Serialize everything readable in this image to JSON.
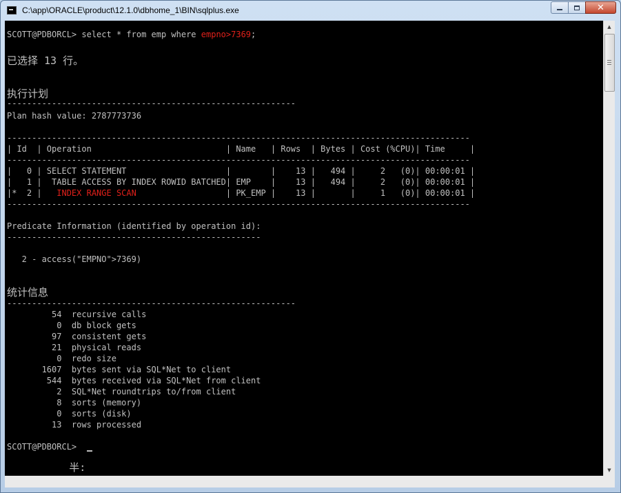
{
  "window": {
    "title": "C:\\app\\ORACLE\\product\\12.1.0\\dbhome_1\\BIN\\sqlplus.exe"
  },
  "console": {
    "lines": [
      {
        "a": "SCOTT@PDBORCL> select * from emp where ",
        "b": "empno>7369",
        "c": ";"
      },
      {
        "a": "已选择 13 行。",
        "b": "",
        "c": ""
      },
      {
        "a": "执行计划",
        "b": "",
        "c": ""
      },
      {
        "a": "----------------------------------------------------------",
        "b": "",
        "c": ""
      },
      {
        "a": "Plan hash value: 2787773736",
        "b": "",
        "c": ""
      },
      {
        "a": "---------------------------------------------------------------------------------------------",
        "b": "",
        "c": ""
      },
      {
        "a": "| Id  | Operation                           | Name   | Rows  | Bytes | Cost (%CPU)| Time     |",
        "b": "",
        "c": ""
      },
      {
        "a": "---------------------------------------------------------------------------------------------",
        "b": "",
        "c": ""
      },
      {
        "a": "|   0 | SELECT STATEMENT                    |        |    13 |   494 |     2   (0)| 00:00:01 |",
        "b": "",
        "c": ""
      },
      {
        "a": "|   1 |  TABLE ACCESS BY INDEX ROWID BATCHED| EMP    |    13 |   494 |     2   (0)| 00:00:01 |",
        "b": "",
        "c": ""
      },
      {
        "a": "|*  2 |   ",
        "b": "INDEX RANGE SCAN",
        "c": "                  | PK_EMP |    13 |       |     1   (0)| 00:00:01 |"
      },
      {
        "a": "---------------------------------------------------------------------------------------------",
        "b": "",
        "c": ""
      },
      {
        "a": "Predicate Information (identified by operation id):",
        "b": "",
        "c": ""
      },
      {
        "a": "---------------------------------------------------",
        "b": "",
        "c": ""
      },
      {
        "a": "   2 - access(\"EMPNO\">7369)",
        "b": "",
        "c": ""
      },
      {
        "a": "统计信息",
        "b": "",
        "c": ""
      },
      {
        "a": "----------------------------------------------------------",
        "b": "",
        "c": ""
      },
      {
        "a": "         54  recursive calls",
        "b": "",
        "c": ""
      },
      {
        "a": "          0  db block gets",
        "b": "",
        "c": ""
      },
      {
        "a": "         97  consistent gets",
        "b": "",
        "c": ""
      },
      {
        "a": "         21  physical reads",
        "b": "",
        "c": ""
      },
      {
        "a": "          0  redo size",
        "b": "",
        "c": ""
      },
      {
        "a": "       1607  bytes sent via SQL*Net to client",
        "b": "",
        "c": ""
      },
      {
        "a": "        544  bytes received via SQL*Net from client",
        "b": "",
        "c": ""
      },
      {
        "a": "          2  SQL*Net roundtrips to/from client",
        "b": "",
        "c": ""
      },
      {
        "a": "          8  sorts (memory)",
        "b": "",
        "c": ""
      },
      {
        "a": "          0  sorts (disk)",
        "b": "",
        "c": ""
      },
      {
        "a": "         13  rows processed",
        "b": "",
        "c": ""
      },
      {
        "a": "SCOTT@PDBORCL> ",
        "b": "",
        "c": ""
      },
      {
        "a": "          半:",
        "b": "",
        "c": ""
      }
    ]
  }
}
